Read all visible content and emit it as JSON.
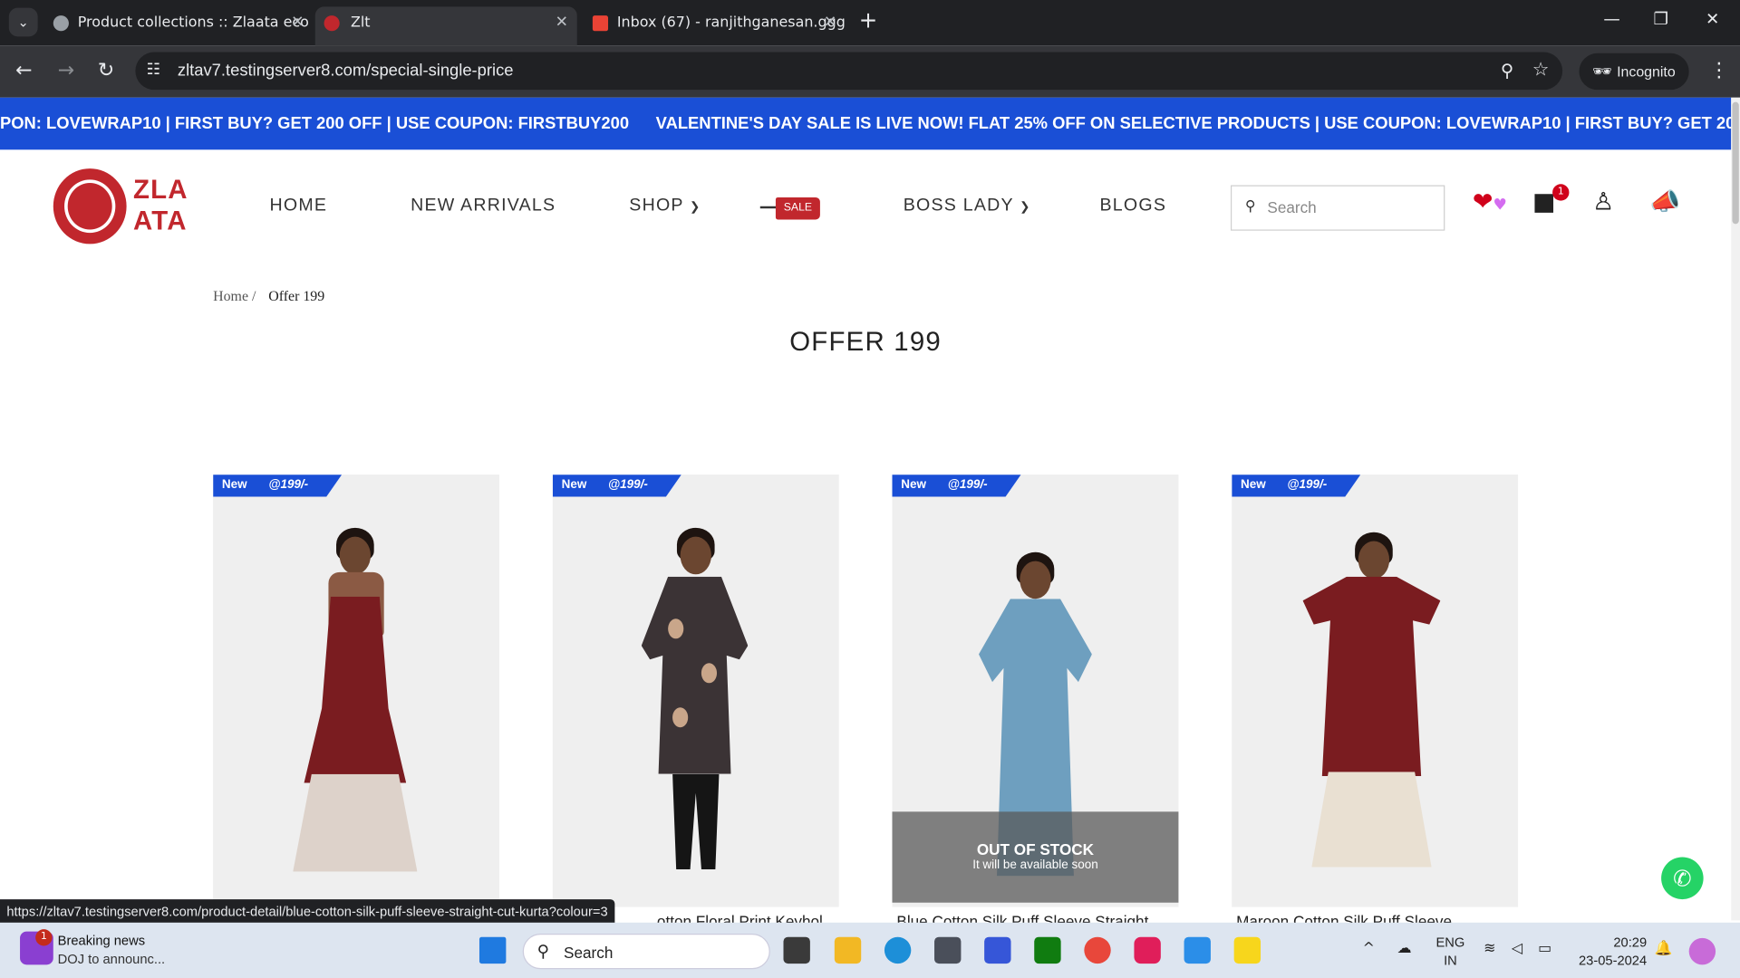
{
  "browser": {
    "tabs": [
      {
        "title": "Product collections :: Zlaata eco"
      },
      {
        "title": "Zlt"
      },
      {
        "title": "Inbox (67) - ranjithganesan.ggg"
      }
    ],
    "url": "zltav7.testingserver8.com/special-single-price",
    "incognito_label": "Incognito"
  },
  "marquee": {
    "text_left": "PON: LOVEWRAP10 | FIRST BUY? GET 200 OFF | USE COUPON: FIRSTBUY200",
    "text_right": "VALENTINE'S DAY SALE IS LIVE NOW! FLAT 25% OFF ON SELECTIVE PRODUCTS | USE COUPON: LOVEWRAP10 | FIRST BUY? GET 200 O"
  },
  "header": {
    "logo_line1": "ZLA",
    "logo_line2": "ATA",
    "nav": {
      "home": "HOME",
      "new_arrivals": "NEW ARRIVALS",
      "shop": "SHOP",
      "sale": "SALE",
      "boss_lady": "BOSS LADY",
      "blogs": "BLOGS"
    },
    "search_placeholder": "Search",
    "cart_count": "1"
  },
  "breadcrumb": {
    "home": "Home /",
    "current": "Offer 199"
  },
  "page_title": "OFFER 199",
  "products": [
    {
      "tag": "New",
      "price": "@199/-",
      "name": ""
    },
    {
      "tag": "New",
      "price": "@199/-",
      "name": "otton Floral Print Keyhol"
    },
    {
      "tag": "New",
      "price": "@199/-",
      "name": "Blue Cotton Silk Puff Sleeve Straight",
      "oos_title": "OUT OF STOCK",
      "oos_sub": "It will be available soon"
    },
    {
      "tag": "New",
      "price": "@199/-",
      "name": "Maroon Cotton Silk Puff Sleeve"
    }
  ],
  "status_url": "https://zltav7.testingserver8.com/product-detail/blue-cotton-silk-puff-sleeve-straight-cut-kurta?colour=3",
  "taskbar": {
    "news_badge": "1",
    "news_title": "Breaking news",
    "news_sub": "DOJ to announc...",
    "search": "Search",
    "lang1": "ENG",
    "lang2": "IN",
    "time": "20:29",
    "date": "23-05-2024"
  },
  "colors": {
    "brand": "#c1272d",
    "banner": "#1a4fd6",
    "chrome_dark": "#202124"
  }
}
